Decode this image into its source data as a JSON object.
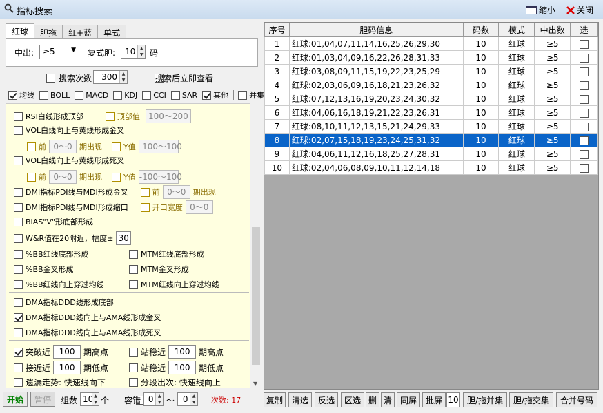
{
  "window": {
    "title": "指标搜索",
    "minimize_label": "缩小",
    "close_label": "关闭"
  },
  "tabs": [
    {
      "label": "红球"
    },
    {
      "label": "胆拖"
    },
    {
      "label": "红+蓝"
    },
    {
      "label": "单式"
    }
  ],
  "filter": {
    "chuzhong_label": "中出:",
    "chuzhong_value": "≥5",
    "fushi_label": "复式胆:",
    "fushi_value": "10",
    "ma_label": "码"
  },
  "search_count": {
    "label": "搜索次数",
    "value": "300",
    "after_label": "搜索后立即查看"
  },
  "indicators": [
    {
      "label": "均线",
      "checked": true
    },
    {
      "label": "BOLL",
      "checked": false
    },
    {
      "label": "MACD",
      "checked": false
    },
    {
      "label": "KDJ",
      "checked": false
    },
    {
      "label": "CCI",
      "checked": false
    },
    {
      "label": "SAR",
      "checked": false
    },
    {
      "label": "其他",
      "checked": true
    },
    {
      "label": "并集",
      "checked": false
    }
  ],
  "conditions": {
    "rsi": {
      "label": "RSI白线形成顶部",
      "top_label": "顶部值",
      "top_value": "100～200"
    },
    "vol_gold": {
      "label": "VOL白线向上与黄线形成金叉",
      "pre_label": "前",
      "pre_value": "0～0",
      "period_label": "期出现",
      "y_label": "Y值",
      "y_value": "-100～100"
    },
    "vol_dead": {
      "label": "VOL白线向上与黄线形成死叉",
      "pre_label": "前",
      "pre_value": "0～0",
      "period_label": "期出现",
      "y_label": "Y值",
      "y_value": "-100～100"
    },
    "dmi_gold": {
      "label": "DMI指标PDI线与MDI形成金叉",
      "pre_label": "前",
      "pre_value": "0～0",
      "period_label": "期出现"
    },
    "dmi_narrow": {
      "label": "DMI指标PDI线与MDI形成缩口",
      "width_label": "开口宽度",
      "width_value": "0～0"
    },
    "bias": {
      "label": "BIAS\"V\"形底部形成"
    },
    "wr": {
      "label": "W&R值在20附近，幅度±",
      "value": "30"
    },
    "bb_bottom": {
      "label": "%BB红线底部形成"
    },
    "mtm_bottom": {
      "label": "MTM红线底部形成"
    },
    "bb_gold": {
      "label": "%BB金叉形成"
    },
    "mtm_gold": {
      "label": "MTM金叉形成"
    },
    "bb_cross": {
      "label": "%BB红线向上穿过均线"
    },
    "mtm_cross": {
      "label": "MTM红线向上穿过均线"
    },
    "dma_bottom": {
      "label": "DMA指标DDD线形成底部"
    },
    "dma_gold": {
      "label": "DMA指标DDD线向上与AMA线形成金叉",
      "checked": true
    },
    "dma_dead": {
      "label": "DMA指标DDD线向上与AMA线形成死叉"
    },
    "break_high": {
      "label": "突破近",
      "value": "100",
      "suffix": "期高点",
      "checked": true
    },
    "stable_high": {
      "label": "站稳近",
      "value": "100",
      "suffix": "期高点"
    },
    "near_low": {
      "label": "接近近",
      "value": "100",
      "suffix": "期低点"
    },
    "stable_low": {
      "label": "站稳近",
      "value": "100",
      "suffix": "期低点"
    },
    "trend_far": {
      "label": "遗漏走势: 快速线向下"
    },
    "trend_seg": {
      "label": "分段出次: 快速线向上"
    }
  },
  "bottom_left": {
    "start": "开始",
    "pause": "暂停",
    "group_label": "组数",
    "group_value": "10",
    "ge_label": "个",
    "tolerance_label": "容错",
    "tol_from": "0",
    "tol_tilde": "～",
    "tol_to": "0",
    "count_label": "次数: 17"
  },
  "table": {
    "headers": [
      "序号",
      "胆码信息",
      "码数",
      "模式",
      "中出数",
      "选"
    ],
    "rows": [
      {
        "no": "1",
        "info": "红球:01,04,07,11,14,16,25,26,29,30",
        "count": "10",
        "mode": "红球",
        "hit": "≥5"
      },
      {
        "no": "2",
        "info": "红球:01,03,04,09,16,22,26,28,31,33",
        "count": "10",
        "mode": "红球",
        "hit": "≥5"
      },
      {
        "no": "3",
        "info": "红球:03,08,09,11,15,19,22,23,25,29",
        "count": "10",
        "mode": "红球",
        "hit": "≥5"
      },
      {
        "no": "4",
        "info": "红球:02,03,06,09,16,18,21,23,26,32",
        "count": "10",
        "mode": "红球",
        "hit": "≥5"
      },
      {
        "no": "5",
        "info": "红球:07,12,13,16,19,20,23,24,30,32",
        "count": "10",
        "mode": "红球",
        "hit": "≥5"
      },
      {
        "no": "6",
        "info": "红球:04,06,16,18,19,21,22,23,26,31",
        "count": "10",
        "mode": "红球",
        "hit": "≥5"
      },
      {
        "no": "7",
        "info": "红球:08,10,11,12,13,15,21,24,29,33",
        "count": "10",
        "mode": "红球",
        "hit": "≥5"
      },
      {
        "no": "8",
        "info": "红球:02,07,15,18,19,23,24,25,31,32",
        "count": "10",
        "mode": "红球",
        "hit": "≥5"
      },
      {
        "no": "9",
        "info": "红球:04,06,11,12,16,18,25,27,28,31",
        "count": "10",
        "mode": "红球",
        "hit": "≥5"
      },
      {
        "no": "10",
        "info": "红球:02,04,06,08,09,10,11,12,14,18",
        "count": "10",
        "mode": "红球",
        "hit": "≥5"
      }
    ]
  },
  "bottom_right": {
    "copy": "复制",
    "clear": "清选",
    "invert": "反选",
    "range": "区选",
    "del": "删",
    "clr": "清",
    "same": "同屏",
    "batch": "批屏",
    "batch_value": "10",
    "union": "胆/拖并集",
    "intersect": "胆/拖交集",
    "merge": "合并号码"
  },
  "colors": {
    "selected_row": "#0a64c8",
    "count_text": "#cc0000",
    "start_text": "#008000"
  }
}
